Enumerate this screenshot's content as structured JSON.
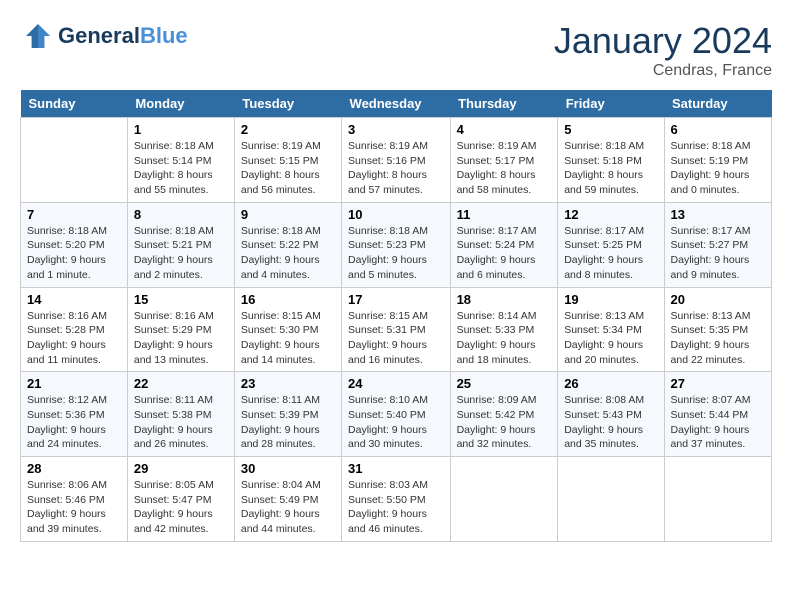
{
  "header": {
    "logo_line1": "General",
    "logo_line2": "Blue",
    "month": "January 2024",
    "location": "Cendras, France"
  },
  "weekdays": [
    "Sunday",
    "Monday",
    "Tuesday",
    "Wednesday",
    "Thursday",
    "Friday",
    "Saturday"
  ],
  "weeks": [
    [
      {
        "day": "",
        "info": ""
      },
      {
        "day": "1",
        "info": "Sunrise: 8:18 AM\nSunset: 5:14 PM\nDaylight: 8 hours\nand 55 minutes."
      },
      {
        "day": "2",
        "info": "Sunrise: 8:19 AM\nSunset: 5:15 PM\nDaylight: 8 hours\nand 56 minutes."
      },
      {
        "day": "3",
        "info": "Sunrise: 8:19 AM\nSunset: 5:16 PM\nDaylight: 8 hours\nand 57 minutes."
      },
      {
        "day": "4",
        "info": "Sunrise: 8:19 AM\nSunset: 5:17 PM\nDaylight: 8 hours\nand 58 minutes."
      },
      {
        "day": "5",
        "info": "Sunrise: 8:18 AM\nSunset: 5:18 PM\nDaylight: 8 hours\nand 59 minutes."
      },
      {
        "day": "6",
        "info": "Sunrise: 8:18 AM\nSunset: 5:19 PM\nDaylight: 9 hours\nand 0 minutes."
      }
    ],
    [
      {
        "day": "7",
        "info": "Sunrise: 8:18 AM\nSunset: 5:20 PM\nDaylight: 9 hours\nand 1 minute."
      },
      {
        "day": "8",
        "info": "Sunrise: 8:18 AM\nSunset: 5:21 PM\nDaylight: 9 hours\nand 2 minutes."
      },
      {
        "day": "9",
        "info": "Sunrise: 8:18 AM\nSunset: 5:22 PM\nDaylight: 9 hours\nand 4 minutes."
      },
      {
        "day": "10",
        "info": "Sunrise: 8:18 AM\nSunset: 5:23 PM\nDaylight: 9 hours\nand 5 minutes."
      },
      {
        "day": "11",
        "info": "Sunrise: 8:17 AM\nSunset: 5:24 PM\nDaylight: 9 hours\nand 6 minutes."
      },
      {
        "day": "12",
        "info": "Sunrise: 8:17 AM\nSunset: 5:25 PM\nDaylight: 9 hours\nand 8 minutes."
      },
      {
        "day": "13",
        "info": "Sunrise: 8:17 AM\nSunset: 5:27 PM\nDaylight: 9 hours\nand 9 minutes."
      }
    ],
    [
      {
        "day": "14",
        "info": "Sunrise: 8:16 AM\nSunset: 5:28 PM\nDaylight: 9 hours\nand 11 minutes."
      },
      {
        "day": "15",
        "info": "Sunrise: 8:16 AM\nSunset: 5:29 PM\nDaylight: 9 hours\nand 13 minutes."
      },
      {
        "day": "16",
        "info": "Sunrise: 8:15 AM\nSunset: 5:30 PM\nDaylight: 9 hours\nand 14 minutes."
      },
      {
        "day": "17",
        "info": "Sunrise: 8:15 AM\nSunset: 5:31 PM\nDaylight: 9 hours\nand 16 minutes."
      },
      {
        "day": "18",
        "info": "Sunrise: 8:14 AM\nSunset: 5:33 PM\nDaylight: 9 hours\nand 18 minutes."
      },
      {
        "day": "19",
        "info": "Sunrise: 8:13 AM\nSunset: 5:34 PM\nDaylight: 9 hours\nand 20 minutes."
      },
      {
        "day": "20",
        "info": "Sunrise: 8:13 AM\nSunset: 5:35 PM\nDaylight: 9 hours\nand 22 minutes."
      }
    ],
    [
      {
        "day": "21",
        "info": "Sunrise: 8:12 AM\nSunset: 5:36 PM\nDaylight: 9 hours\nand 24 minutes."
      },
      {
        "day": "22",
        "info": "Sunrise: 8:11 AM\nSunset: 5:38 PM\nDaylight: 9 hours\nand 26 minutes."
      },
      {
        "day": "23",
        "info": "Sunrise: 8:11 AM\nSunset: 5:39 PM\nDaylight: 9 hours\nand 28 minutes."
      },
      {
        "day": "24",
        "info": "Sunrise: 8:10 AM\nSunset: 5:40 PM\nDaylight: 9 hours\nand 30 minutes."
      },
      {
        "day": "25",
        "info": "Sunrise: 8:09 AM\nSunset: 5:42 PM\nDaylight: 9 hours\nand 32 minutes."
      },
      {
        "day": "26",
        "info": "Sunrise: 8:08 AM\nSunset: 5:43 PM\nDaylight: 9 hours\nand 35 minutes."
      },
      {
        "day": "27",
        "info": "Sunrise: 8:07 AM\nSunset: 5:44 PM\nDaylight: 9 hours\nand 37 minutes."
      }
    ],
    [
      {
        "day": "28",
        "info": "Sunrise: 8:06 AM\nSunset: 5:46 PM\nDaylight: 9 hours\nand 39 minutes."
      },
      {
        "day": "29",
        "info": "Sunrise: 8:05 AM\nSunset: 5:47 PM\nDaylight: 9 hours\nand 42 minutes."
      },
      {
        "day": "30",
        "info": "Sunrise: 8:04 AM\nSunset: 5:49 PM\nDaylight: 9 hours\nand 44 minutes."
      },
      {
        "day": "31",
        "info": "Sunrise: 8:03 AM\nSunset: 5:50 PM\nDaylight: 9 hours\nand 46 minutes."
      },
      {
        "day": "",
        "info": ""
      },
      {
        "day": "",
        "info": ""
      },
      {
        "day": "",
        "info": ""
      }
    ]
  ]
}
